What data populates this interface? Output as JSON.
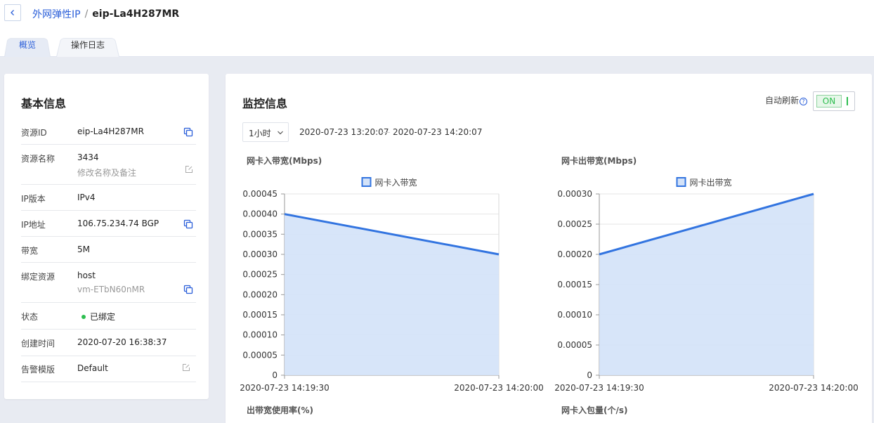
{
  "header": {
    "breadcrumb_parent": "外网弹性IP",
    "breadcrumb_separator": "/",
    "breadcrumb_current": "eip-La4H287MR"
  },
  "tabs": [
    {
      "label": "概览",
      "active": true
    },
    {
      "label": "操作日志",
      "active": false
    }
  ],
  "basic_info": {
    "title": "基本信息",
    "rows": [
      {
        "label": "资源ID",
        "value": "eip-La4H287MR",
        "icon": "copy-icon"
      },
      {
        "label": "资源名称",
        "value": "3434",
        "sub": "修改名称及备注",
        "icon": "edit-icon"
      },
      {
        "label": "IP版本",
        "value": "IPv4"
      },
      {
        "label": "IP地址",
        "value": "106.75.234.74 BGP",
        "icon": "copy-icon"
      },
      {
        "label": "带宽",
        "value": "5M"
      },
      {
        "label": "绑定资源",
        "value": "host",
        "sub": "vm-ETbN60nMR",
        "icon": "copy-icon"
      },
      {
        "label": "状态",
        "value": "已绑定",
        "status_color": "#2dbe4f"
      },
      {
        "label": "创建时间",
        "value": "2020-07-20 16:38:37"
      },
      {
        "label": "告警模版",
        "value": "Default",
        "icon": "edit-icon"
      }
    ]
  },
  "monitor": {
    "title": "监控信息",
    "auto_refresh_label": "自动刷新",
    "auto_refresh_state": "ON",
    "range_option": "1小时",
    "range_start": "2020-07-23 13:20:07",
    "range_end": "2020-07-23 14:20:07",
    "bottom_titles": [
      "出带宽使用率(%)",
      "网卡入包量(个/s)"
    ]
  },
  "chart_data": [
    {
      "type": "area",
      "title": "网卡入带宽(Mbps)",
      "legend": "网卡入带宽",
      "x": [
        "2020-07-23 14:19:30",
        "2020-07-23 14:20:00"
      ],
      "values": [
        0.0004,
        0.0003
      ],
      "ylim": [
        0,
        0.00045
      ],
      "yticks": [
        "0.00045",
        "0.00040",
        "0.00035",
        "0.00030",
        "0.00025",
        "0.00020",
        "0.00015",
        "0.00010",
        "0.00005",
        "0"
      ],
      "color": "#3274e0",
      "fill": "#d3e2f8",
      "grid": true,
      "legend_position": "top-center"
    },
    {
      "type": "area",
      "title": "网卡出带宽(Mbps)",
      "legend": "网卡出带宽",
      "x": [
        "2020-07-23 14:19:30",
        "2020-07-23 14:20:00"
      ],
      "values": [
        0.0002,
        0.0003
      ],
      "ylim": [
        0,
        0.0003
      ],
      "yticks": [
        "0.00030",
        "0.00025",
        "0.00020",
        "0.00015",
        "0.00010",
        "0.00005",
        "0"
      ],
      "color": "#3274e0",
      "fill": "#d3e2f8",
      "grid": true,
      "legend_position": "top-center"
    }
  ],
  "colors": {
    "accent": "#2b5fd9",
    "status_ok": "#2dbe4f",
    "page_bg": "#e8ebf2"
  }
}
